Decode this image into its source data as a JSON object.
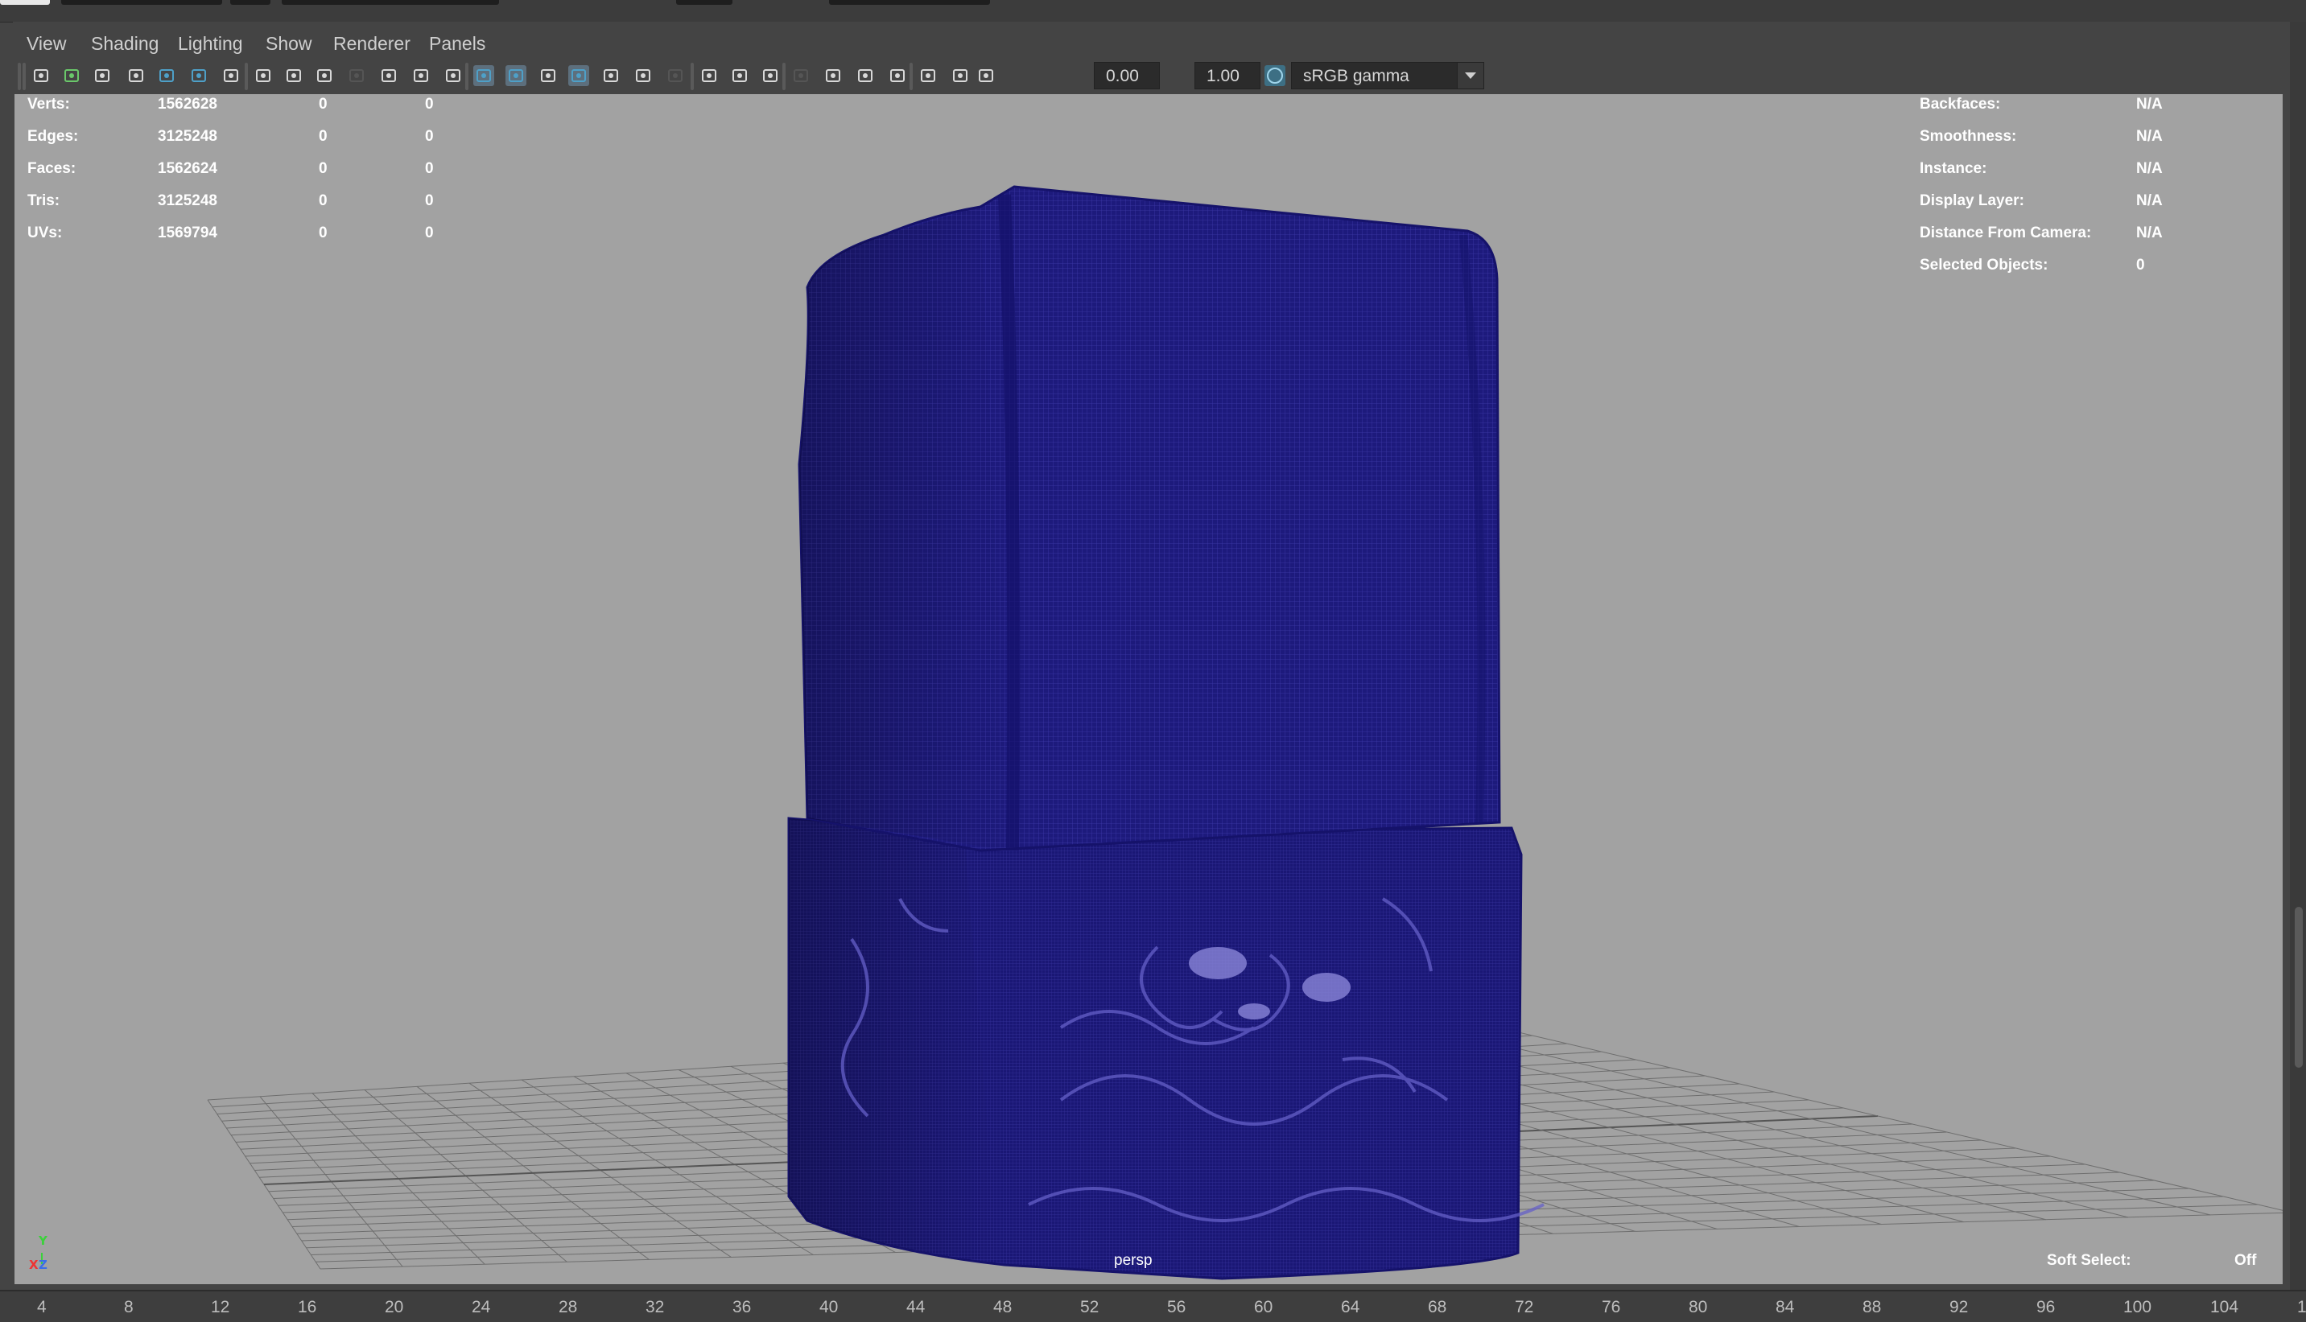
{
  "menu": [
    "View",
    "Shading",
    "Lighting",
    "Show",
    "Renderer",
    "Panels"
  ],
  "toolbar": {
    "exposure": "0.00",
    "gamma": "1.00",
    "colorspace": "sRGB gamma",
    "icons": [
      "camera-icon",
      "lock-camera-icon",
      "camera-attributes-icon",
      "bookmark-icon",
      "image-plane-icon",
      "2d-pan-zoom-icon",
      "grease-pencil-icon",
      "grid-icon",
      "film-gate-icon",
      "resolution-gate-icon",
      "gate-mask-icon",
      "field-chart-icon",
      "safe-action-icon",
      "safe-title-icon",
      "wireframe-icon",
      "smooth-shade-icon",
      "wireframe-on-shaded-icon",
      "default-material-icon",
      "xray-icon",
      "lights-icon",
      "shadows-icon",
      "ambient-occlusion-icon",
      "motion-blur-icon",
      "antialiasing-icon",
      "depth-of-field-icon",
      "isolate-select-icon",
      "xray-joints-icon",
      "xray-active-icon",
      "backface-culling-icon",
      "exposure-icon",
      "gamma-icon",
      "color-management-icon",
      "dropdown-arrow-icon"
    ]
  },
  "hud_left": [
    {
      "label": "Verts:",
      "v1": "1562628",
      "v2": "0",
      "v3": "0"
    },
    {
      "label": "Edges:",
      "v1": "3125248",
      "v2": "0",
      "v3": "0"
    },
    {
      "label": "Faces:",
      "v1": "1562624",
      "v2": "0",
      "v3": "0"
    },
    {
      "label": "Tris:",
      "v1": "3125248",
      "v2": "0",
      "v3": "0"
    },
    {
      "label": "UVs:",
      "v1": "1569794",
      "v2": "0",
      "v3": "0"
    }
  ],
  "hud_right": [
    {
      "label": "Backfaces:",
      "value": "N/A"
    },
    {
      "label": "Smoothness:",
      "value": "N/A"
    },
    {
      "label": "Instance:",
      "value": "N/A"
    },
    {
      "label": "Display Layer:",
      "value": "N/A"
    },
    {
      "label": "Distance From Camera:",
      "value": "N/A"
    },
    {
      "label": "Selected Objects:",
      "value": "0"
    }
  ],
  "camera_label": "persp",
  "soft_select": {
    "label": "Soft Select:",
    "value": "Off"
  },
  "axis": {
    "y": "Y",
    "x": "X",
    "z": "Z"
  },
  "timeline_ticks": [
    "4",
    "8",
    "12",
    "16",
    "20",
    "24",
    "28",
    "32",
    "36",
    "40",
    "44",
    "48",
    "52",
    "56",
    "60",
    "64",
    "68",
    "72",
    "76",
    "80",
    "84",
    "88",
    "92",
    "96",
    "100",
    "104",
    "1"
  ],
  "colors": {
    "mesh": "#1e1a80",
    "viewport_bg": "#a2a2a2",
    "grid": "#6e6e6e",
    "accent": "#4ea0c8"
  }
}
